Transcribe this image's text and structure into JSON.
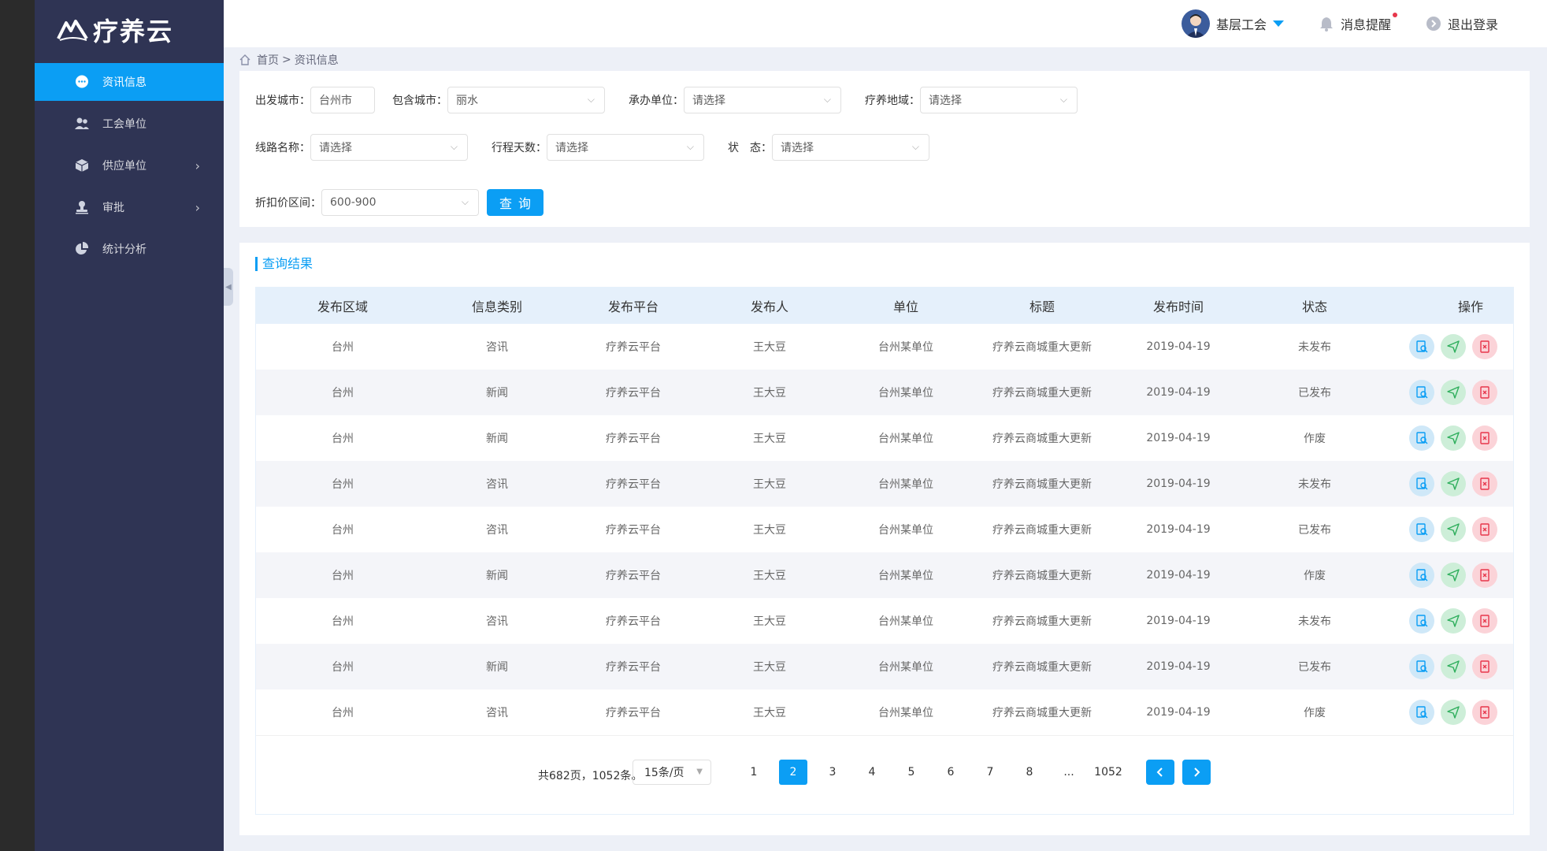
{
  "app": {
    "logo_text": "疗养云"
  },
  "header": {
    "user_name": "基层工会",
    "messages_label": "消息提醒",
    "logout_label": "退出登录"
  },
  "breadcrumb": {
    "home": "首页",
    "separator": ">",
    "current": "资讯信息"
  },
  "sidebar": {
    "items": [
      {
        "label": "资讯信息",
        "icon": "chat-icon",
        "active": true
      },
      {
        "label": "工会单位",
        "icon": "users-icon"
      },
      {
        "label": "供应单位",
        "icon": "cube-icon",
        "has_arrow": true
      },
      {
        "label": "审批",
        "icon": "stamp-icon",
        "has_arrow": true
      },
      {
        "label": "统计分析",
        "icon": "pie-icon"
      }
    ]
  },
  "filters": {
    "departure_label": "出发城市：",
    "departure_value": "台州市",
    "include_label": "包含城市：",
    "include_value": "丽水",
    "organizer_label": "承办单位：",
    "organizer_value": "请选择",
    "region_label": "疗养地域：",
    "region_value": "请选择",
    "route_label": "线路名称：",
    "route_value": "请选择",
    "days_label": "行程天数：",
    "days_value": "请选择",
    "status_label": "状　态：",
    "status_value": "请选择",
    "discount_label": "折扣价区间：",
    "discount_value": "600-900",
    "query_button": "查询"
  },
  "results": {
    "title": "查询结果",
    "columns": [
      "发布区域",
      "信息类别",
      "发布平台",
      "发布人",
      "单位",
      "标题",
      "发布时间",
      "状态",
      "操作"
    ],
    "rows": [
      [
        "台州",
        "咨讯",
        "疗养云平台",
        "王大豆",
        "台州某单位",
        "疗养云商城重大更新",
        "2019-04-19",
        "未发布"
      ],
      [
        "台州",
        "新闻",
        "疗养云平台",
        "王大豆",
        "台州某单位",
        "疗养云商城重大更新",
        "2019-04-19",
        "已发布"
      ],
      [
        "台州",
        "新闻",
        "疗养云平台",
        "王大豆",
        "台州某单位",
        "疗养云商城重大更新",
        "2019-04-19",
        "作废"
      ],
      [
        "台州",
        "咨讯",
        "疗养云平台",
        "王大豆",
        "台州某单位",
        "疗养云商城重大更新",
        "2019-04-19",
        "未发布"
      ],
      [
        "台州",
        "咨讯",
        "疗养云平台",
        "王大豆",
        "台州某单位",
        "疗养云商城重大更新",
        "2019-04-19",
        "已发布"
      ],
      [
        "台州",
        "新闻",
        "疗养云平台",
        "王大豆",
        "台州某单位",
        "疗养云商城重大更新",
        "2019-04-19",
        "作废"
      ],
      [
        "台州",
        "咨讯",
        "疗养云平台",
        "王大豆",
        "台州某单位",
        "疗养云商城重大更新",
        "2019-04-19",
        "未发布"
      ],
      [
        "台州",
        "新闻",
        "疗养云平台",
        "王大豆",
        "台州某单位",
        "疗养云商城重大更新",
        "2019-04-19",
        "已发布"
      ],
      [
        "台州",
        "咨讯",
        "疗养云平台",
        "王大豆",
        "台州某单位",
        "疗养云商城重大更新",
        "2019-04-19",
        "作废"
      ]
    ]
  },
  "pagination": {
    "total_text": "共682页，1052条。",
    "page_size": "15条/页",
    "pages": [
      "1",
      "2",
      "3",
      "4",
      "5",
      "6",
      "7",
      "8",
      "...",
      "1052"
    ],
    "current": "2",
    "prev_icon": "chevron-left-icon",
    "next_icon": "chevron-right-icon"
  },
  "colors": {
    "sidebar": "#2f3454",
    "accent": "#0b9ef4",
    "page_bg": "#edf0f7",
    "header_row": "#e5f0fb",
    "alt_row": "#f4f5f9"
  }
}
